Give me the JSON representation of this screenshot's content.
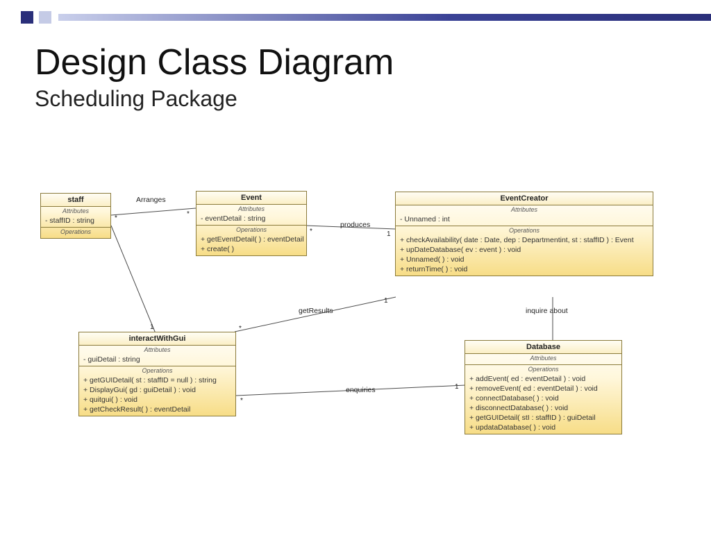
{
  "header": {
    "title": "Design Class Diagram",
    "subtitle": "Scheduling Package"
  },
  "classes": {
    "staff": {
      "name": "staff",
      "attr_label": "Attributes",
      "op_label": "Operations",
      "attributes": [
        "- staffID : string"
      ],
      "operations": []
    },
    "event": {
      "name": "Event",
      "attr_label": "Attributes",
      "op_label": "Operations",
      "attributes": [
        "- eventDetail : string"
      ],
      "operations": [
        "+ getEventDetail(  ) : eventDetail",
        "+ create(  )"
      ]
    },
    "eventCreator": {
      "name": "EventCreator",
      "attr_label": "Attributes",
      "op_label": "Operations",
      "attributes": [
        "- Unnamed : int"
      ],
      "operations": [
        "+ checkAvailability( date : Date, dep : Departmentint, st : staffID ) : Event",
        "+ upDateDatabase( ev : event ) : void",
        "+ Unnamed(  ) : void",
        "+ returnTime(  ) : void"
      ]
    },
    "interactWithGui": {
      "name": "interactWithGui",
      "attr_label": "Attributes",
      "op_label": "Operations",
      "attributes": [
        "- guiDetail : string"
      ],
      "operations": [
        "+ getGUIDetail( st : staffID =  null ) : string",
        "+ DisplayGui( gd : guiDetail ) : void",
        "+ quitgui(  ) : void",
        "+ getCheckResult(  ) : eventDetail"
      ]
    },
    "database": {
      "name": "Database",
      "attr_label": "Attributes",
      "op_label": "Operations",
      "attributes": [],
      "operations": [
        "+ addEvent( ed : eventDetail ) : void",
        "+ removeEvent( ed : eventDetail ) : void",
        "+ connectDatabase(  ) : void",
        "+ disconnectDatabase(  ) : void",
        "+ getGUIDetail( stI : staffID ) : guiDetail",
        "+ updataDatabase(  ) : void"
      ]
    }
  },
  "associations": {
    "arranges": {
      "label": "Arranges",
      "m1": "*",
      "m2": "*"
    },
    "produces": {
      "label": "produces",
      "m1": "*",
      "m2": "1"
    },
    "getResults": {
      "label": "getResults",
      "m1": "*",
      "m2": "1"
    },
    "enquiries": {
      "label": "enquiries",
      "m1": "*",
      "m2": "1"
    },
    "inquireAbout": {
      "label": "inquire about"
    },
    "staffToGui": {
      "m1": "1"
    }
  }
}
